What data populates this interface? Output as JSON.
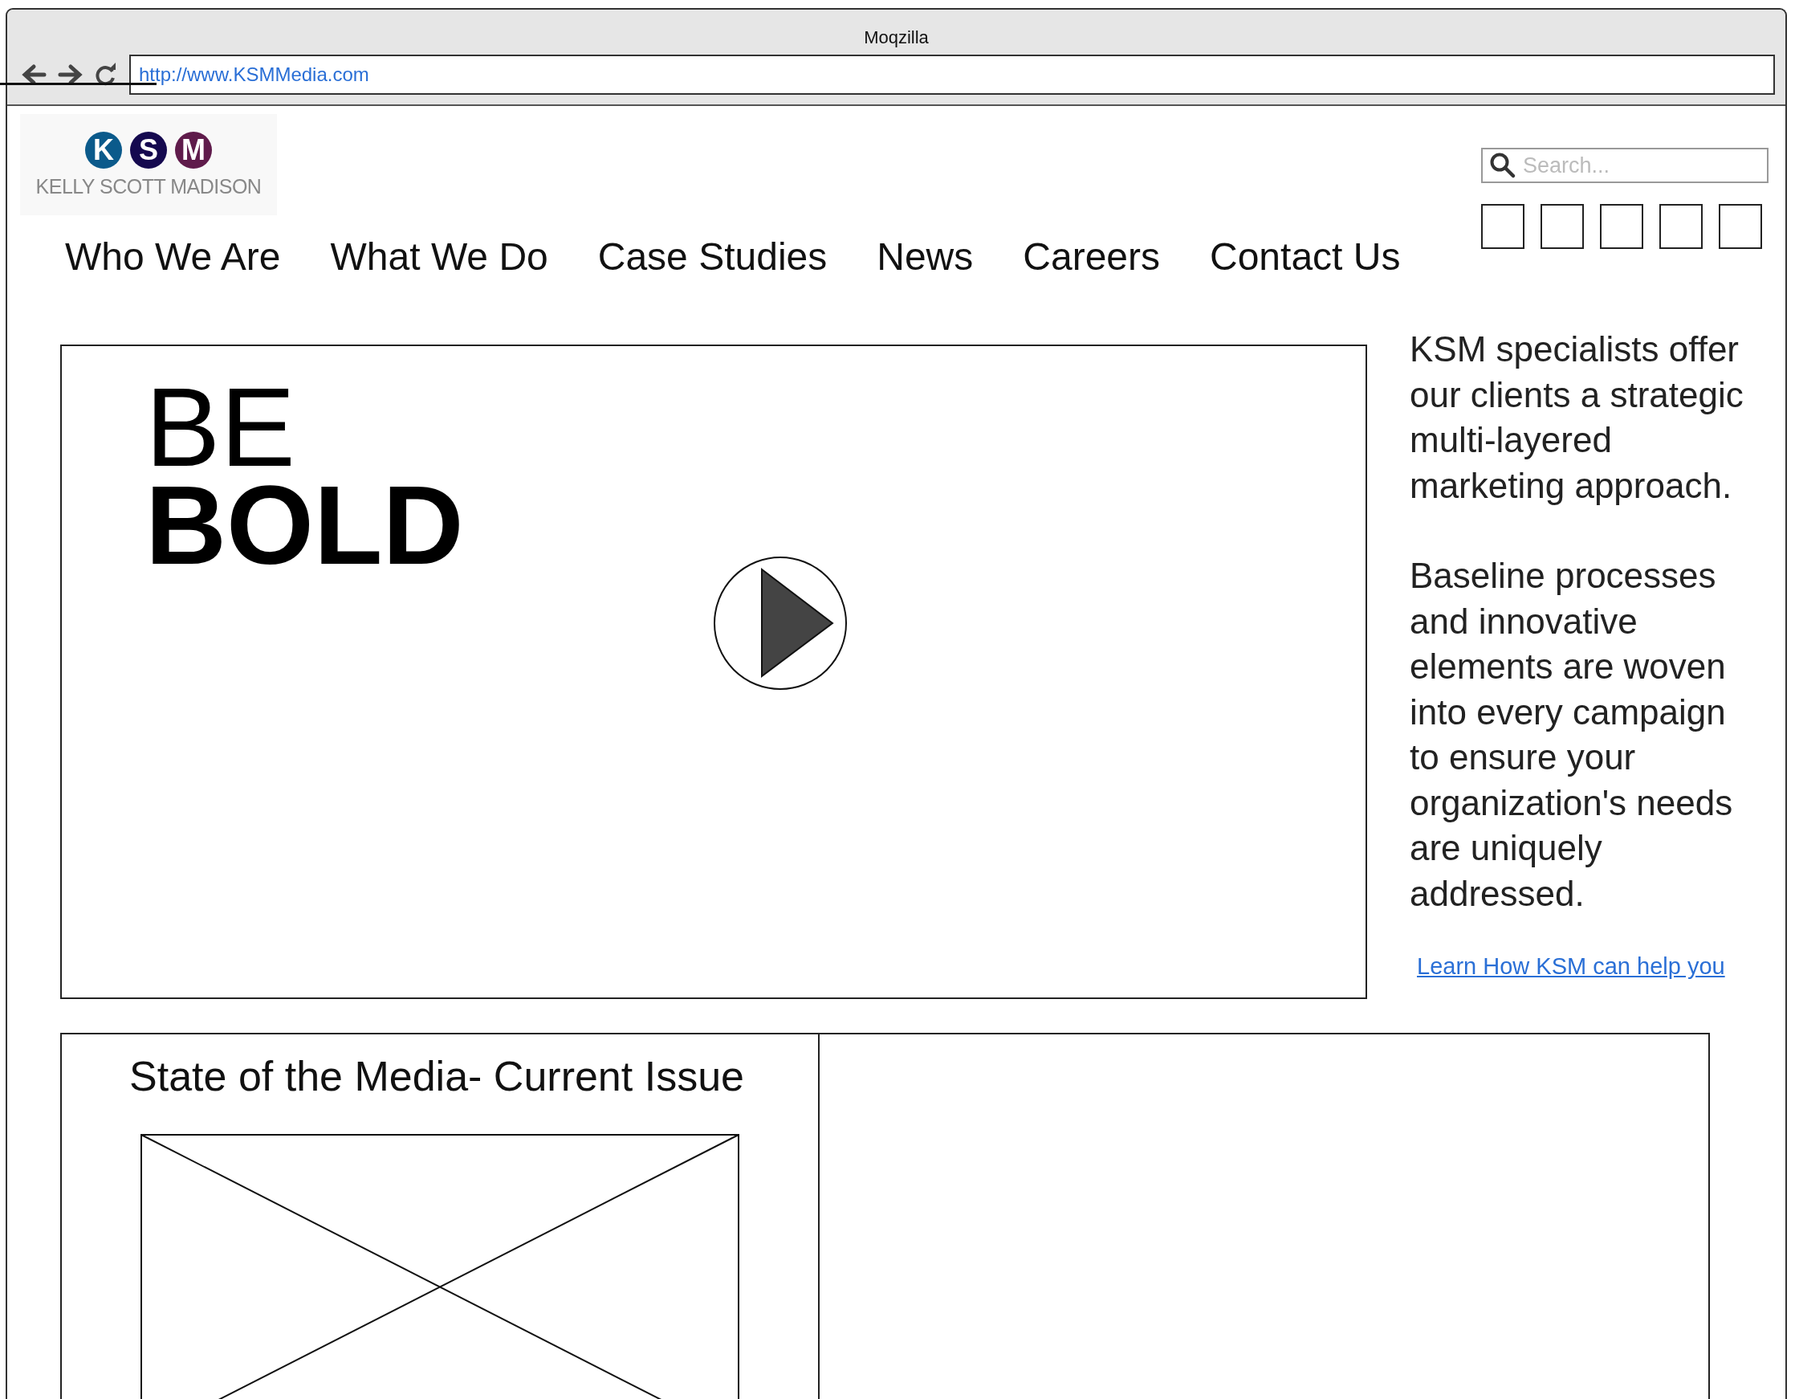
{
  "window": {
    "title": "Moqzilla",
    "url": "http://www.KSMMedia.com"
  },
  "logo": {
    "letters": [
      {
        "text": "K",
        "color": "#0b5a8b"
      },
      {
        "text": "S",
        "color": "#15094f"
      },
      {
        "text": "M",
        "color": "#5f1b4b"
      }
    ],
    "name": "KELLY SCOTT MADISON"
  },
  "search": {
    "placeholder": "Search..."
  },
  "social_links": [
    {
      "kind": "placeholder"
    },
    {
      "kind": "placeholder"
    },
    {
      "kind": "placeholder"
    },
    {
      "kind": "placeholder"
    },
    {
      "kind": "placeholder"
    }
  ],
  "nav": [
    "Who We Are",
    "What We Do",
    "Case Studies",
    "News",
    "Careers",
    "Contact Us"
  ],
  "hero": {
    "headline": [
      {
        "text": "BE",
        "bold": false
      },
      {
        "text": "BOLD",
        "bold": true
      }
    ],
    "video": {
      "kind": "play"
    }
  },
  "aside": {
    "paragraphs": [
      "KSM specialists offer our clients a strategic multi-layered marketing approach.",
      "Baseline processes and innovative elements are woven into every campaign to ensure your organization's needs are uniquely addressed."
    ],
    "link": "Learn How KSM can help you"
  },
  "issue": {
    "title": "State of the Media- Current Issue",
    "image": {
      "kind": "placeholder"
    }
  }
}
